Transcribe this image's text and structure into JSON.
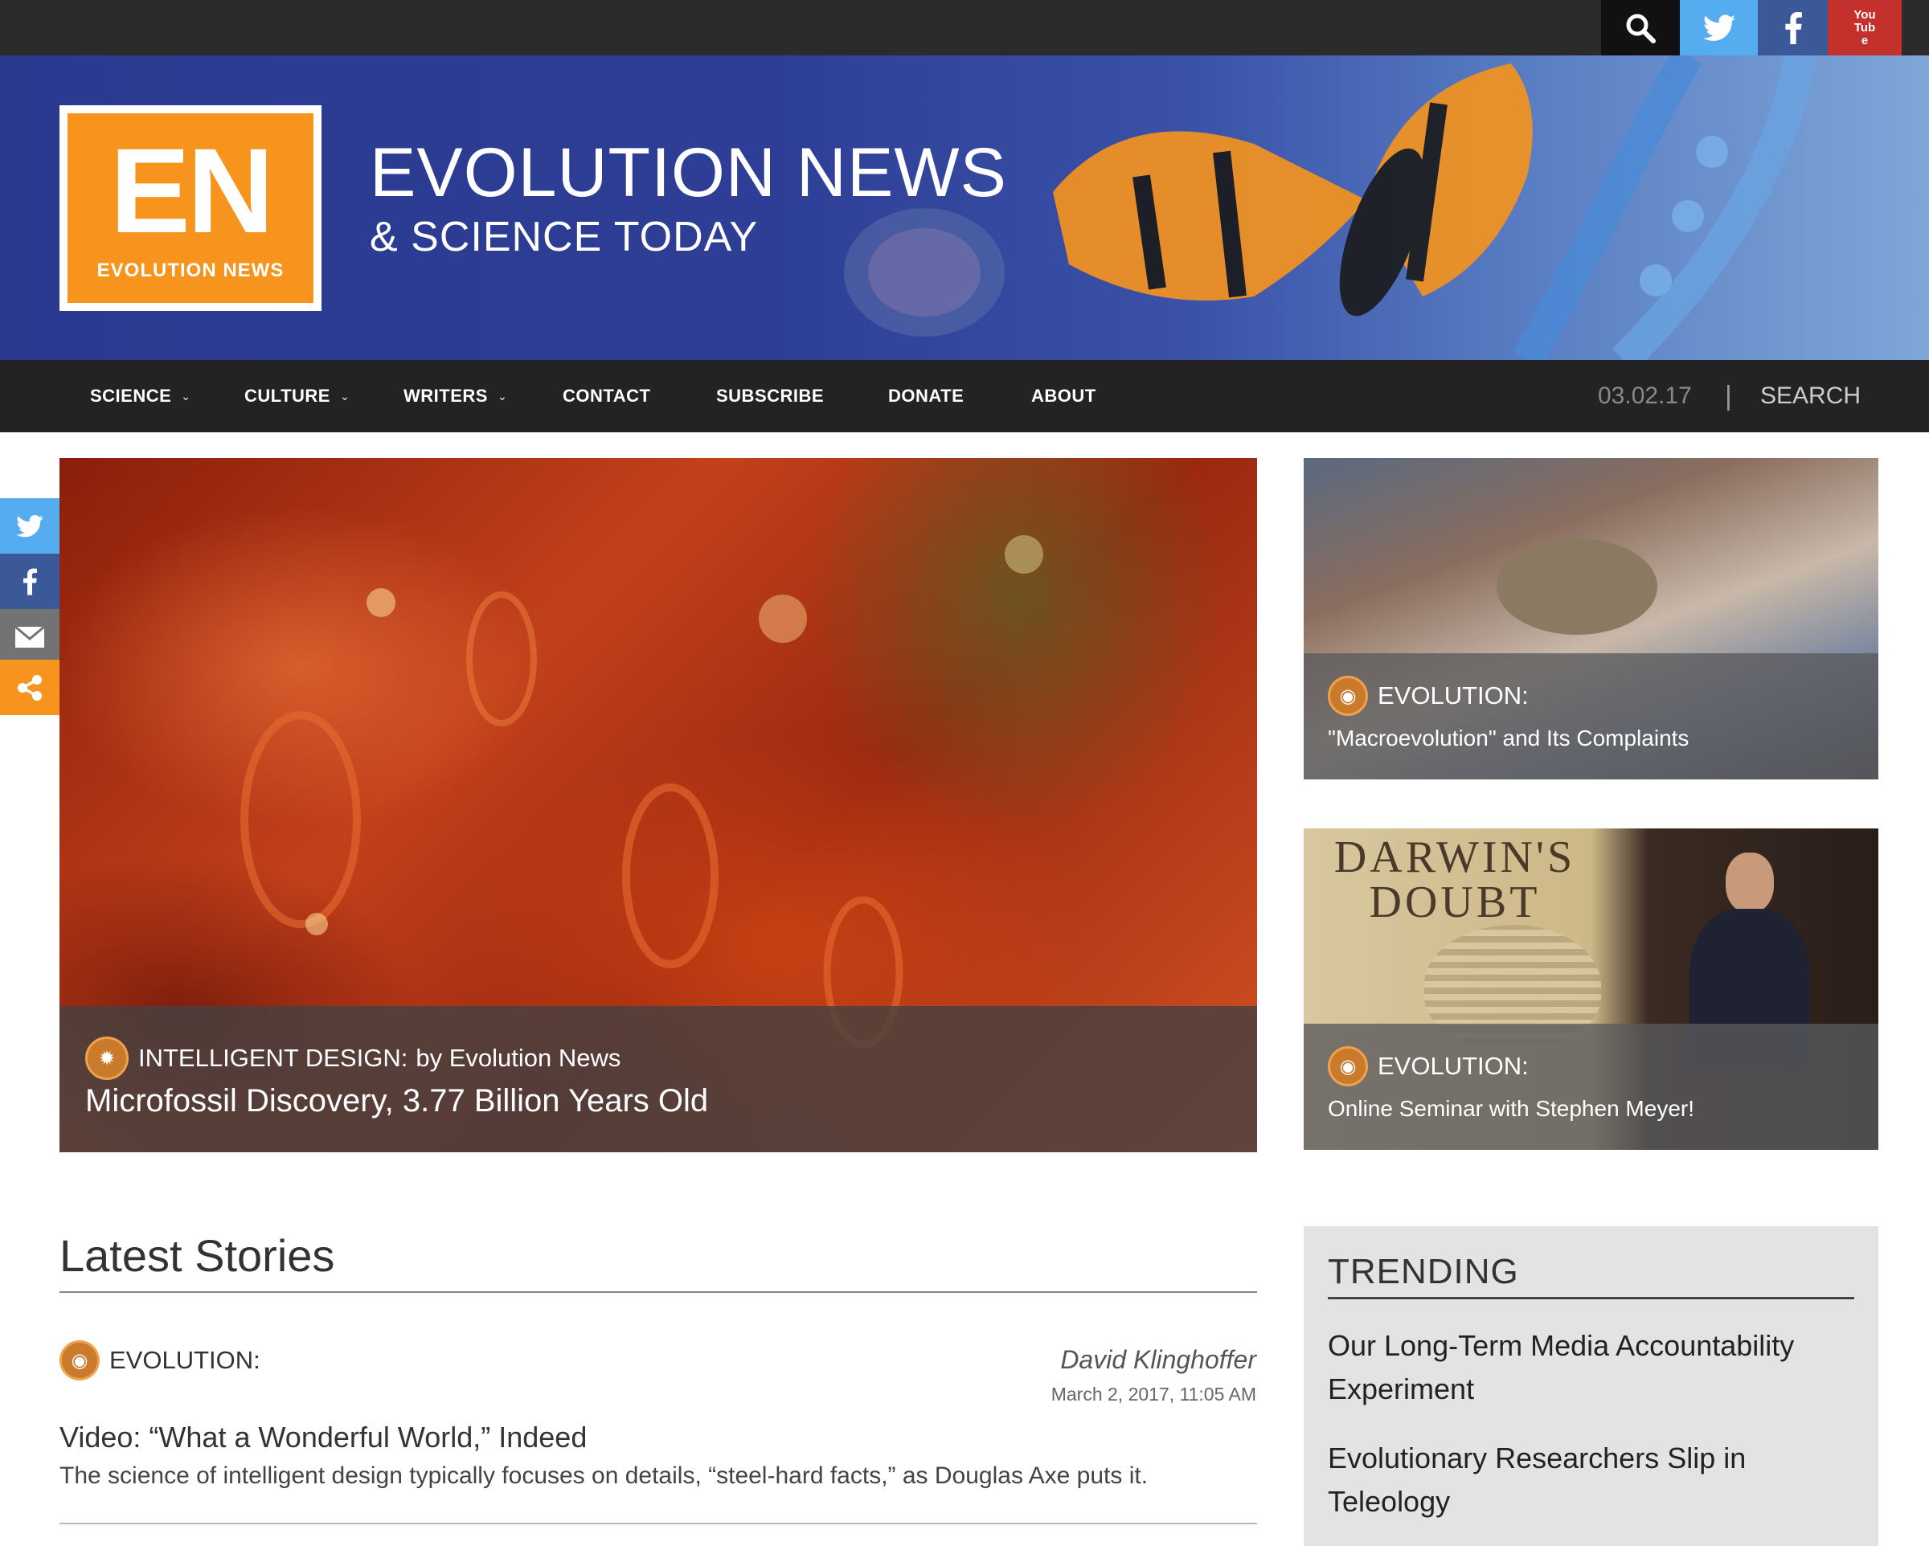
{
  "site": {
    "logo_letters": "EN",
    "logo_caption": "EVOLUTION NEWS",
    "title": "EVOLUTION NEWS",
    "subtitle": "& SCIENCE TODAY"
  },
  "topbar": {
    "icons": [
      "search-icon",
      "twitter-icon",
      "facebook-icon",
      "youtube-icon"
    ],
    "youtube_label": "You Tube"
  },
  "nav": {
    "items": [
      {
        "label": "SCIENCE",
        "dropdown": true
      },
      {
        "label": "CULTURE",
        "dropdown": true
      },
      {
        "label": "WRITERS",
        "dropdown": true
      },
      {
        "label": "CONTACT",
        "dropdown": false
      },
      {
        "label": "SUBSCRIBE",
        "dropdown": false
      },
      {
        "label": "DONATE",
        "dropdown": false
      },
      {
        "label": "ABOUT",
        "dropdown": false
      }
    ],
    "date": "03.02.17",
    "separator": "|",
    "search_label": "SEARCH"
  },
  "share": {
    "icons": [
      "twitter-icon",
      "facebook-icon",
      "email-icon",
      "share-icon"
    ]
  },
  "hero": {
    "category": "INTELLIGENT DESIGN:",
    "byline": "by Evolution News",
    "title": "Microfossil Discovery, 3.77 Billion Years Old"
  },
  "cards": [
    {
      "category": "EVOLUTION:",
      "title": "\"Macroevolution\" and Its Complaints"
    },
    {
      "category": "EVOLUTION:",
      "title": "Online Seminar with Stephen Meyer!",
      "image_text": "DARWIN'S DOUBT"
    }
  ],
  "latest": {
    "heading": "Latest Stories",
    "stories": [
      {
        "category": "EVOLUTION:",
        "author": "David Klinghoffer",
        "date": "March 2, 2017, 11:05 AM",
        "title": "Video: “What a Wonderful World,” Indeed",
        "excerpt": "The science of intelligent design typically focuses on details, “steel-hard facts,” as Douglas Axe puts it."
      }
    ]
  },
  "trending": {
    "heading": "TRENDING",
    "items": [
      "Our Long-Term Media Accountability Experiment",
      "Evolutionary Researchers Slip in Teleology"
    ]
  },
  "colors": {
    "brand_orange": "#f7941d",
    "banner_blue": "#2e3e96",
    "nav_dark": "#232323",
    "twitter": "#55acee",
    "facebook": "#3b5998",
    "youtube": "#c4302b"
  }
}
